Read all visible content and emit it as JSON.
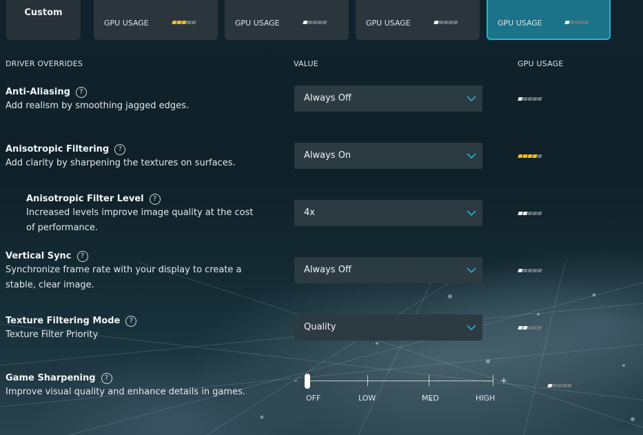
{
  "presets": [
    {
      "title": "Custom"
    },
    {
      "gpu_label": "GPU USAGE",
      "level": 3
    },
    {
      "gpu_label": "GPU USAGE",
      "level": 1
    },
    {
      "gpu_label": "GPU USAGE",
      "level": 1
    },
    {
      "gpu_label": "GPU USAGE",
      "level": 1,
      "selected": true
    }
  ],
  "headers": {
    "overrides": "DRIVER OVERRIDES",
    "value": "VALUE",
    "gpu": "GPU USAGE"
  },
  "help_glyph": "?",
  "rows": [
    {
      "title": "Anti-Aliasing",
      "desc": "Add realism by smoothing jagged edges.",
      "value": "Always Off",
      "level": 1
    },
    {
      "title": "Anisotropic Filtering",
      "desc": "Add clarity by sharpening the textures on surfaces.",
      "value": "Always On",
      "level": 4
    },
    {
      "title": "Anisotropic Filter Level",
      "desc": "Increased levels improve image quality at the cost of performance.",
      "value": "4x",
      "level": 2
    },
    {
      "title": "Vertical Sync",
      "desc": "Synchronize frame rate with your display to create a stable, clear image.",
      "value": "Always Off",
      "level": 1
    },
    {
      "title": "Texture Filtering Mode",
      "desc": "Texture Filter Priority",
      "value": "Quality",
      "level": 2
    },
    {
      "title": "Game Sharpening",
      "desc": "Improve visual quality and enhance details in games.",
      "level": 1
    }
  ],
  "slider": {
    "minus": "-",
    "plus": "+",
    "labels": [
      "OFF",
      "LOW",
      "MED",
      "HIGH"
    ],
    "value": "OFF"
  },
  "colors": {
    "accent": "#23b5cf",
    "selected_card": "#1a7388",
    "meter_on": "#eef2f4",
    "meter_high": "#f2c01e",
    "meter_off": "#6a757b"
  }
}
